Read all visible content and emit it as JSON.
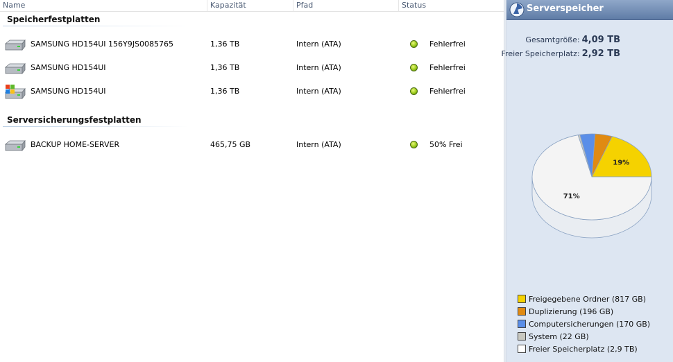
{
  "columns": [
    "Name",
    "Kapazität",
    "Pfad",
    "Status"
  ],
  "sections": [
    {
      "title": "Speicherfestplatten",
      "drives": [
        {
          "name": "SAMSUNG HD154UI 156Y9JS0085765",
          "capacity": "1,36 TB",
          "path": "Intern (ATA)",
          "status": "Fehlerfrei",
          "icon": "hard-drive-icon"
        },
        {
          "name": "SAMSUNG HD154UI",
          "capacity": "1,36 TB",
          "path": "Intern (ATA)",
          "status": "Fehlerfrei",
          "icon": "hard-drive-icon"
        },
        {
          "name": "SAMSUNG HD154UI",
          "capacity": "1,36 TB",
          "path": "Intern (ATA)",
          "status": "Fehlerfrei",
          "icon": "system-drive-icon"
        }
      ]
    },
    {
      "title": "Serversicherungsfestplatten",
      "drives": [
        {
          "name": "BACKUP HOME-SERVER",
          "capacity": "465,75 GB",
          "path": "Intern (ATA)",
          "status": "50% Frei",
          "icon": "hard-drive-icon"
        }
      ]
    }
  ],
  "panel": {
    "title": "Serverspeicher",
    "total_label": "Gesamtgröße:",
    "total_value": "4,09 TB",
    "free_label": "Freier Speicherplatz:",
    "free_value": "2,92 TB"
  },
  "colors": {
    "status_ok": "#8fc31f",
    "panel_bg": "#dde6f2"
  },
  "chart_data": {
    "type": "pie",
    "slices": [
      {
        "label": "Freigegebene Ordner (817 GB)",
        "value": 817,
        "color": "#f5d200",
        "data_label": "19%"
      },
      {
        "label": "Duplizierung (196 GB)",
        "value": 196,
        "color": "#e08a12",
        "data_label": ""
      },
      {
        "label": "Computersicherungen (170 GB)",
        "value": 170,
        "color": "#5a8ee8",
        "data_label": ""
      },
      {
        "label": "System (22 GB)",
        "value": 22,
        "color": "#c8c8c0",
        "data_label": ""
      },
      {
        "label": "Freier Speicherplatz (2,9 TB)",
        "value": 2990,
        "color": "#f4f4f4",
        "data_label": "71%"
      }
    ],
    "legend_position": "bottom-left"
  }
}
